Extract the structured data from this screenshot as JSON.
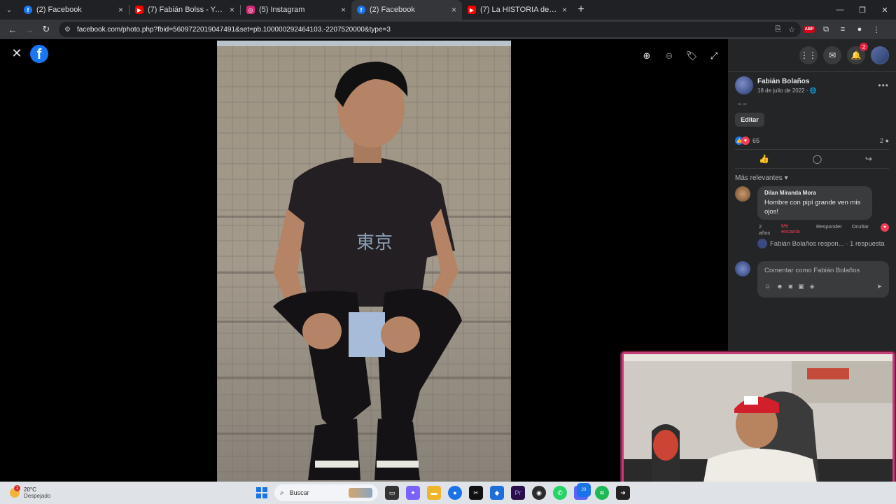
{
  "browser": {
    "tabs": [
      {
        "title": "(2) Facebook",
        "favicon": "facebook-icon",
        "color": "#1877f2",
        "active": false
      },
      {
        "title": "(7) Fabián Bolss - YouTube",
        "favicon": "youtube-icon",
        "color": "#ff0000",
        "active": false
      },
      {
        "title": "(5) Instagram",
        "favicon": "instagram-icon",
        "color": "#d62976",
        "active": false
      },
      {
        "title": "(2) Facebook",
        "favicon": "facebook-icon",
        "color": "#1877f2",
        "active": true
      },
      {
        "title": "(7) La HISTORIA de LA JOAQUI",
        "favicon": "youtube-icon",
        "color": "#ff0000",
        "active": false
      }
    ],
    "url": "facebook.com/photo.php?fbid=560972201904749​1&set=pb.100000292464103.-2207520000&type=3"
  },
  "viewer": {
    "tools": [
      "zoom-in-icon",
      "zoom-out-icon",
      "tag-icon",
      "fullscreen-icon"
    ]
  },
  "header_right": {
    "notifications_badge": "2"
  },
  "post": {
    "author": "Fabián Bolaños",
    "date": "18 de julio de 2022 ·",
    "caption": "‒ ‒",
    "edit_label": "Editar",
    "reaction_count": "65",
    "comment_count": "2",
    "sort_label": "Más relevantes"
  },
  "comment": {
    "author": "Dilan Miranda Mora",
    "text": "Hombre con pipí grande ven mis ojos!",
    "age": "2 años",
    "love_label": "Me encanta",
    "reply_label": "Responder",
    "hide_label": "Ocultar",
    "reply_summary": "Fabián Bolaños respon... · 1 respuesta"
  },
  "composer": {
    "placeholder": "Comentar como Fabián Bolaños"
  },
  "taskbar": {
    "temperature": "20°C",
    "weather": "Despejado",
    "weather_badge": "1",
    "search_placeholder": "Buscar",
    "discord_badge": "23"
  }
}
